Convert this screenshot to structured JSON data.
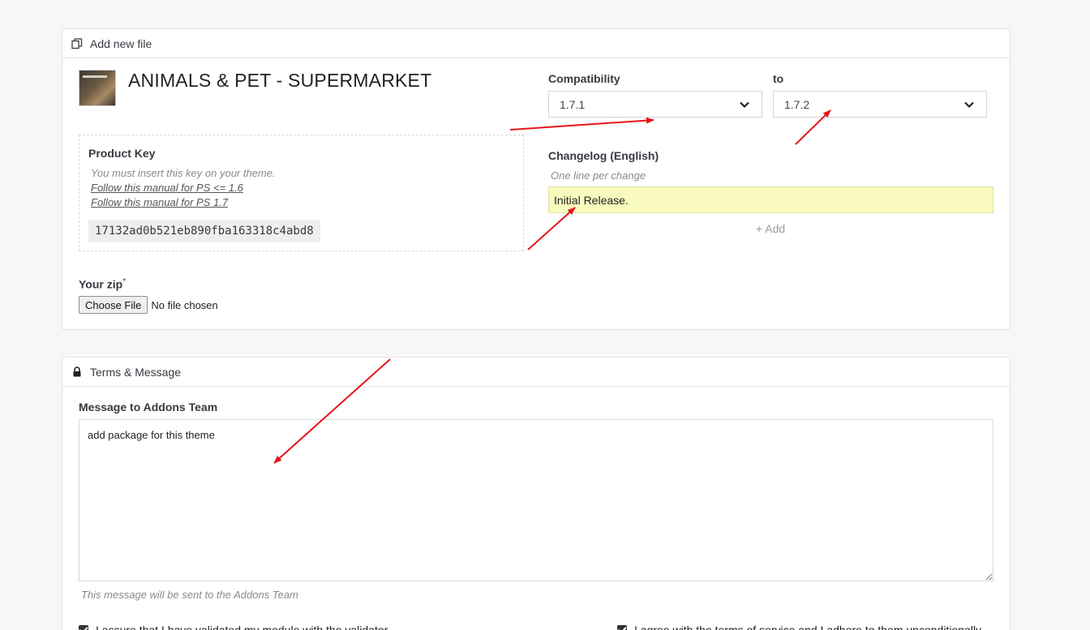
{
  "file_panel": {
    "header": "Add new file",
    "product_title": "ANIMALS & PET - SUPERMARKET",
    "product_key": {
      "label": "Product Key",
      "hint": "You must insert this key on your theme.",
      "link_ps16": "Follow this manual for PS <= 1.6",
      "link_ps17": "Follow this manual for PS 1.7",
      "key": "17132ad0b521eb890fba163318c4abd8"
    },
    "zip": {
      "label": "Your zip",
      "required_mark": "*",
      "button": "Choose File",
      "status": "No file chosen"
    },
    "compatibility": {
      "label": "Compatibility",
      "from_value": "1.7.1",
      "to_label": "to",
      "to_value": "1.7.2"
    },
    "changelog": {
      "label": "Changelog (English)",
      "hint": "One line per change",
      "value": "Initial Release.",
      "add_label": "+ Add"
    }
  },
  "terms_panel": {
    "header": "Terms & Message",
    "message_label": "Message to Addons Team",
    "message_value": "add package for this theme",
    "message_hint": "This message will be sent to the Addons Team",
    "checkbox_validator": "I assure that I have validated my module with the validator",
    "checkbox_terms": "I agree with the terms of service and I adhere to them unconditionally"
  },
  "colors": {
    "changelog_highlight": "#f8fbbd",
    "annotation_arrow": "#e8141b"
  },
  "icons": {
    "add_file": "copy-icon",
    "terms": "lock-icon",
    "select": "chevron-down-icon"
  }
}
